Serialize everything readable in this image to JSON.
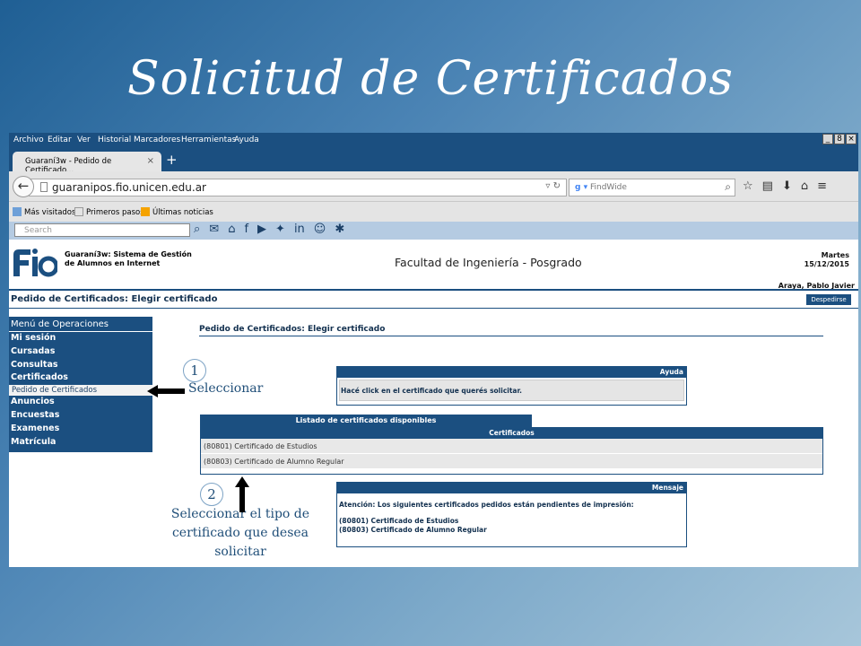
{
  "slide": {
    "title": "Solicitud de Certificados"
  },
  "browser": {
    "menu": [
      "Archivo",
      "Editar",
      "Ver",
      "Historial",
      "Marcadores",
      "Herramientas",
      "Ayuda"
    ],
    "tab_title": "Guaraní3w - Pedido de Certificado...",
    "tab_close": "×",
    "new_tab": "+",
    "url": "guaranipos.fio.unicen.edu.ar",
    "search_placeholder": "FindWide",
    "bookmarks": [
      "Más visitados",
      "Primeros pasos",
      "Últimas noticias"
    ],
    "site_search_placeholder": "Search",
    "window_buttons": [
      "_",
      "8",
      "×"
    ]
  },
  "site": {
    "system_name_line1": "Guaraní3w: Sistema de Gestión",
    "system_name_line2": "de Alumnos en Internet",
    "faculty": "Facultad de Ingeniería - Posgrado",
    "day": "Martes",
    "date": "15/12/2015",
    "user": "Araya, Pablo Javier",
    "page_heading": "Pedido de Certificados: Elegir certificado",
    "logout_label": "Despedirse"
  },
  "menu": {
    "header": "Menú de Operaciones",
    "items": [
      "Mi sesión",
      "Cursadas",
      "Consultas",
      "Certificados"
    ],
    "subitem": "Pedido de Certificados",
    "items_after": [
      "Anuncios",
      "Encuestas",
      "Examenes",
      "Matrícula"
    ]
  },
  "content": {
    "title": "Pedido de Certificados: Elegir certificado",
    "help_header": "Ayuda",
    "help_text": "Hacé click en el certificado que querés solicitar.",
    "list_tab": "Listado de certificados disponibles",
    "list_header": "Certificados",
    "certificates": [
      "(80801) Certificado de Estudios",
      "(80803) Certificado de Alumno Regular"
    ],
    "message_header": "Mensaje",
    "message_text": "Atención: Los siguientes certificados pedidos están pendientes de impresión:",
    "pending": [
      "(80801) Certificado de Estudios",
      "(80803) Certificado de Alumno Regular"
    ]
  },
  "annotations": {
    "step1_number": "1",
    "step1_text": "Seleccionar",
    "step2_number": "2",
    "step2_line1": "Seleccionar el tipo de",
    "step2_line2": "certificado que desea",
    "step2_line3": "solicitar"
  },
  "colors": {
    "brand": "#1b4f80",
    "header_strip": "#b5cbe2"
  }
}
